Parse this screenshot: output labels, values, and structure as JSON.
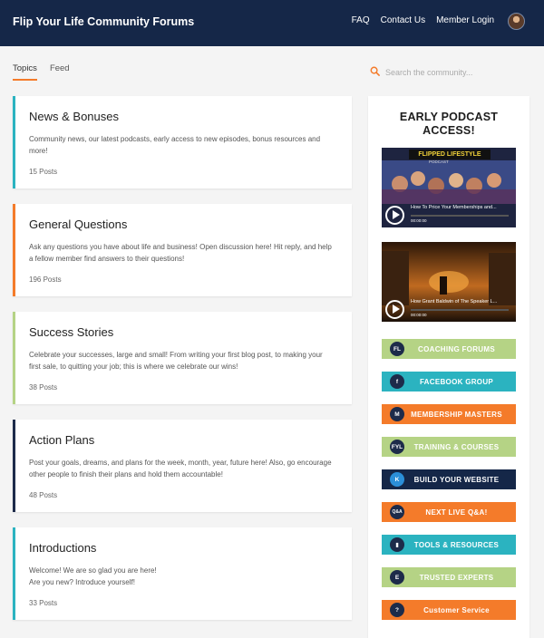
{
  "header": {
    "brand": "Flip Your Life Community Forums",
    "nav": [
      "FAQ",
      "Contact Us",
      "Member Login"
    ]
  },
  "tabs": [
    {
      "label": "Topics",
      "active": true
    },
    {
      "label": "Feed",
      "active": false
    }
  ],
  "search": {
    "placeholder": "Search the community..."
  },
  "forums": [
    {
      "title": "News & Bonuses",
      "description": "Community news, our latest podcasts, early access to new episodes, bonus resources and more!",
      "count": "15 Posts",
      "accent": "#2bb3c0"
    },
    {
      "title": "General Questions",
      "description": "Ask any questions you have about life and business! Open discussion here! Hit reply, and help a fellow member find answers to their questions!",
      "count": "196 Posts",
      "accent": "#f47b2a"
    },
    {
      "title": "Success Stories",
      "description": "Celebrate your successes, large and small! From writing your first blog post, to making your first sale, to quitting your job; this is where we celebrate our wins!",
      "count": "38 Posts",
      "accent": "#b5d385"
    },
    {
      "title": "Action Plans",
      "description": "Post your goals, dreams, and plans for the week, month, year, future here! Also, go encourage other people to finish their plans and hold them accountable!",
      "count": "48 Posts",
      "accent": "#1d2b4a"
    },
    {
      "title": "Introductions",
      "description": "Welcome! We are so glad you are here!\nAre you new? Introduce yourself!",
      "count": "33 Posts",
      "accent": "#2bb3c0"
    }
  ],
  "sidebar": {
    "title": "EARLY PODCAST\nACCESS!",
    "videos": [
      {
        "banner": "FLIPPED LIFESTYLE",
        "subbanner": "PODCAST",
        "title": "How To Price Your Memberships and...",
        "time": "00:00:00"
      },
      {
        "banner": "",
        "subbanner": "",
        "title": "How Grant Baldwin of The Speaker L...",
        "time": "00:00:00"
      }
    ],
    "buttons": [
      {
        "label": "COACHING FORUMS",
        "icon_text": "FL",
        "bg": "#b5d385",
        "icon_bg": "#1d2b4a"
      },
      {
        "label": "FACEBOOK GROUP",
        "icon_text": "f",
        "bg": "#2bb3c0",
        "icon_bg": "#1d2b4a"
      },
      {
        "label": "MEMBERSHIP MASTERS",
        "icon_text": "M",
        "bg": "#f47b2a",
        "icon_bg": "#1d2b4a"
      },
      {
        "label": "TRAINING & COURSES",
        "icon_text": "FYL",
        "bg": "#b5d385",
        "icon_bg": "#1d2b4a"
      },
      {
        "label": "BUILD YOUR WEBSITE",
        "icon_text": "K",
        "bg": "#152748",
        "icon_bg": "#2b8fd8"
      },
      {
        "label": "NEXT LIVE Q&A!",
        "icon_text": "Q&A",
        "bg": "#f47b2a",
        "icon_bg": "#1d2b4a"
      },
      {
        "label": "TOOLS & RESOURCES",
        "icon_text": "▮",
        "bg": "#2bb3c0",
        "icon_bg": "#1d2b4a"
      },
      {
        "label": "TRUSTED EXPERTS",
        "icon_text": "E",
        "bg": "#b5d385",
        "icon_bg": "#1d2b4a"
      },
      {
        "label": "Customer Service",
        "icon_text": "?",
        "bg": "#f47b2a",
        "icon_bg": "#1d2b4a"
      }
    ]
  },
  "colors": {
    "header_bg": "#152748",
    "accent_orange": "#f47b2a",
    "accent_teal": "#2bb3c0",
    "accent_green": "#b5d385"
  }
}
